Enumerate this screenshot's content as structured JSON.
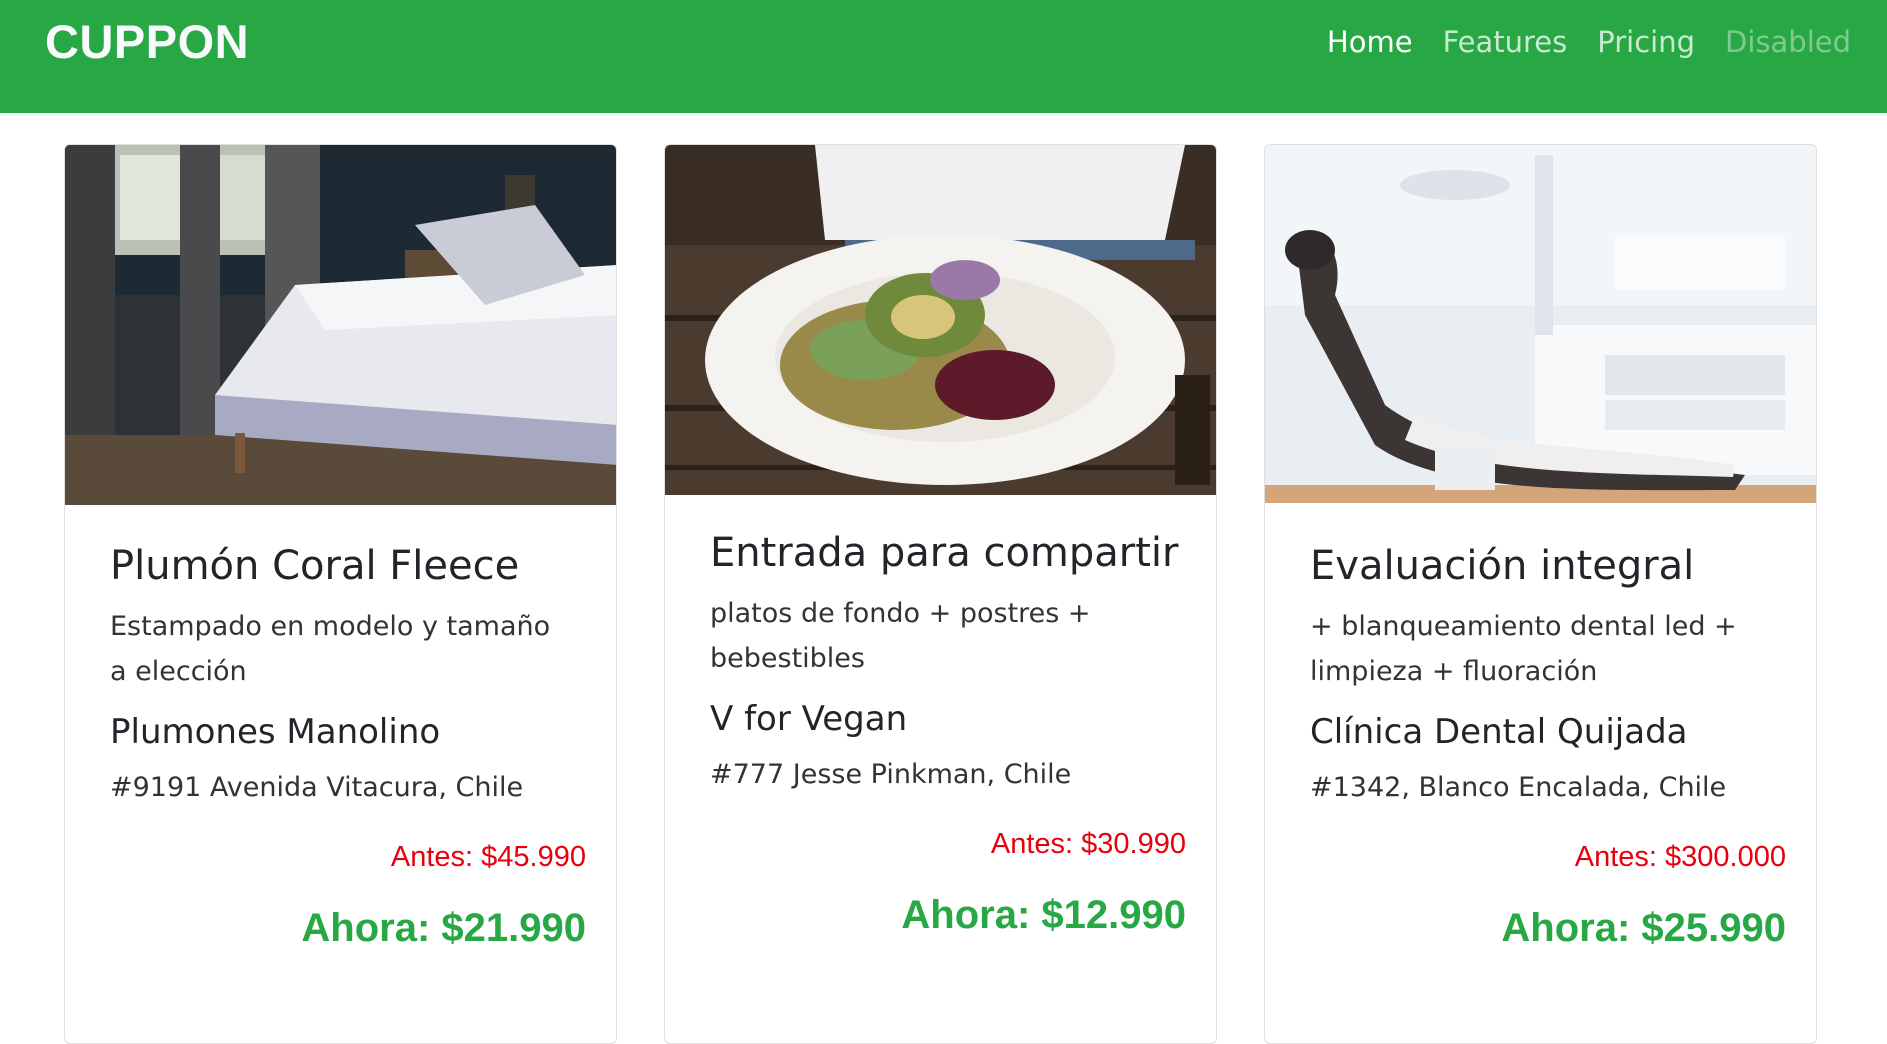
{
  "brand": "CUPPON",
  "nav": {
    "items": [
      {
        "label": "Home",
        "state": "active"
      },
      {
        "label": "Features",
        "state": "normal"
      },
      {
        "label": "Pricing",
        "state": "normal"
      },
      {
        "label": "Disabled",
        "state": "disabled"
      }
    ]
  },
  "colors": {
    "brand_green": "#28a745",
    "price_before_red": "#e8000e",
    "price_now_green": "#28a745"
  },
  "cards": [
    {
      "image": "bedroom-bed-photo",
      "title": "Plumón Coral Fleece",
      "description": "Estampado en modelo y tamaño a elección",
      "merchant": "Plumones Manolino",
      "address": "#9191 Avenida Vitacura, Chile",
      "price_before": "Antes: $45.990",
      "price_now": "Ahora: $21.990"
    },
    {
      "image": "vegan-salad-plate-photo",
      "title": "Entrada para compartir",
      "description": "platos de fondo + postres + bebestibles",
      "merchant": "V for Vegan",
      "address": "#777 Jesse Pinkman, Chile",
      "price_before": "Antes: $30.990",
      "price_now": "Ahora: $12.990"
    },
    {
      "image": "dental-chair-photo",
      "title": "Evaluación integral",
      "description": "+ blanqueamiento dental led + limpieza + fluoración",
      "merchant": "Clínica Dental Quijada",
      "address": "#1342, Blanco Encalada, Chile",
      "price_before": "Antes: $300.000",
      "price_now": "Ahora: $25.990"
    }
  ]
}
